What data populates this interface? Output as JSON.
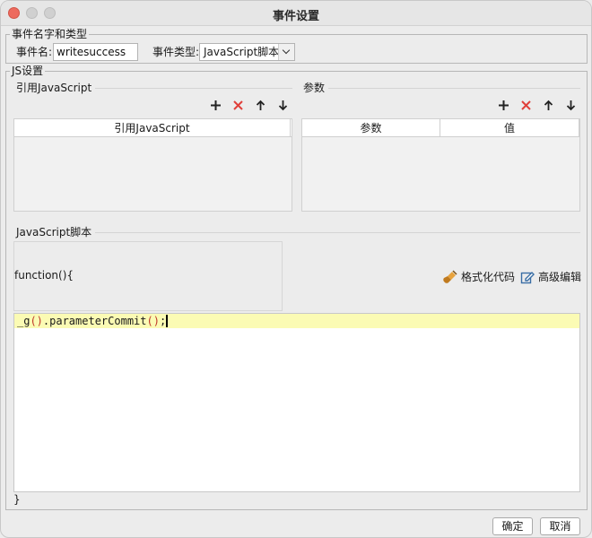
{
  "window": {
    "title": "事件设置"
  },
  "event_group": {
    "legend": "事件名字和类型",
    "name_label": "事件名:",
    "name_value": "writesuccess",
    "type_label": "事件类型:",
    "type_value": "JavaScript脚本"
  },
  "js_group": {
    "legend": "JS设置",
    "ref_section": {
      "title": "引用JavaScript",
      "columns": [
        "引用JavaScript"
      ],
      "rows": []
    },
    "param_section": {
      "title": "参数",
      "columns": [
        "参数",
        "值"
      ],
      "rows": []
    },
    "script_section": {
      "title": "JavaScript脚本",
      "function_open": "function(){",
      "format_label": "格式化代码",
      "advanced_label": "高级编辑",
      "code": {
        "prefix": "_g",
        "paren1": "()",
        "method": ".parameterCommit",
        "paren2": "()",
        "suffix": ";"
      },
      "function_close": "}"
    }
  },
  "footer": {
    "ok_label": "确定",
    "cancel_label": "取消"
  },
  "icons": {
    "add": "plus-icon",
    "delete": "delete-x-icon",
    "up": "arrow-up-icon",
    "down": "arrow-down-icon",
    "format": "brush-icon",
    "advanced": "edit-icon"
  },
  "colors": {
    "delete": "#e0403a",
    "highlight": "#fbfbb4",
    "paren": "#c0392b"
  }
}
